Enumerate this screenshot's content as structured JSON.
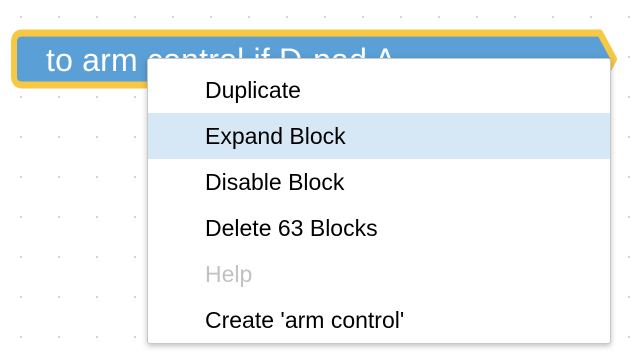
{
  "block": {
    "label": "to arm control  if D-pad A",
    "fill_color": "#5aa0d6",
    "selected_outline_color": "#f7c843"
  },
  "context_menu": {
    "items": [
      {
        "label": "Duplicate",
        "state": "normal"
      },
      {
        "label": "Expand Block",
        "state": "highlighted"
      },
      {
        "label": "Disable Block",
        "state": "normal"
      },
      {
        "label": "Delete 63 Blocks",
        "state": "normal"
      },
      {
        "label": "Help",
        "state": "disabled"
      },
      {
        "label": "Create 'arm control'",
        "state": "normal"
      }
    ]
  },
  "colors": {
    "menu_highlight": "#d6e8f5",
    "disabled_text": "#c2c2c2",
    "grid_dot": "#d4d4d4"
  }
}
